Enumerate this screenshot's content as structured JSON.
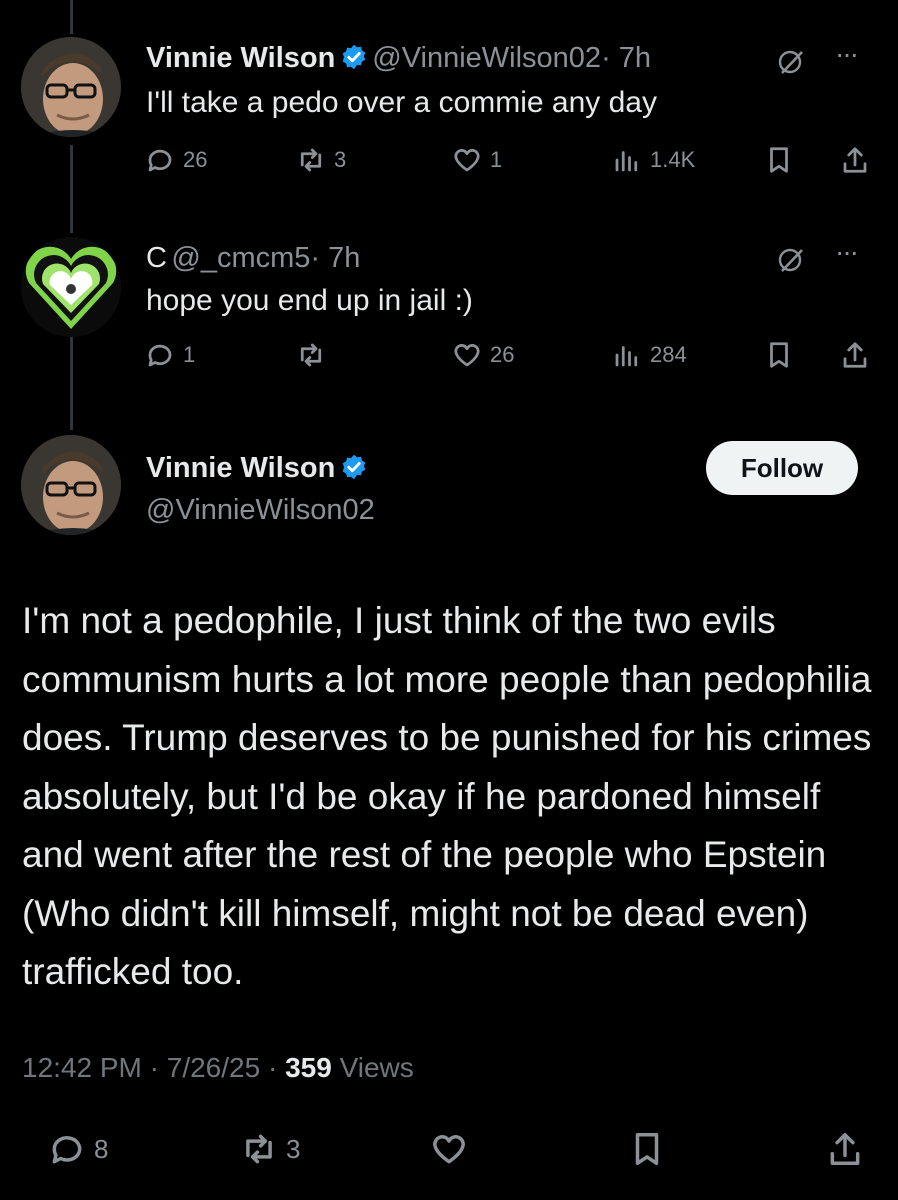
{
  "tweet1": {
    "name": "Vinnie Wilson",
    "handle": "@VinnieWilson02",
    "time": "· 7h",
    "text": "I'll take a pedo over a commie any day",
    "replies": "26",
    "retweets": "3",
    "likes": "1",
    "views": "1.4K"
  },
  "tweet2": {
    "name": "C",
    "handle": "@_cmcm5",
    "time": "· 7h",
    "text": "hope you end up in jail :)",
    "replies": "1",
    "retweets": "",
    "likes": "26",
    "views": "284"
  },
  "main": {
    "name": "Vinnie Wilson",
    "handle": "@VinnieWilson02",
    "follow_label": "Follow",
    "body": "I'm not a pedophile, I just think of the two evils communism hurts a lot more people than pedophilia does. Trump deserves to be punished for his crimes absolutely, but I'd be okay if he pardoned himself and went after the rest of the people who Epstein (Who didn't kill himself, might not be dead even) trafficked too.",
    "time": "12:42 PM",
    "date": "7/26/25",
    "views_count": "359",
    "views_label": "Views",
    "replies": "8",
    "retweets": "3"
  },
  "colors": {
    "background": "#000000",
    "text": "#e7e9ea",
    "muted": "#71767b",
    "verified": "#1d9bf0",
    "avatar_green": "#7fd44a"
  },
  "icons": [
    "reply-icon",
    "retweet-icon",
    "like-icon",
    "views-icon",
    "bookmark-icon",
    "share-icon",
    "grok-icon",
    "more-icon",
    "verified-icon"
  ]
}
